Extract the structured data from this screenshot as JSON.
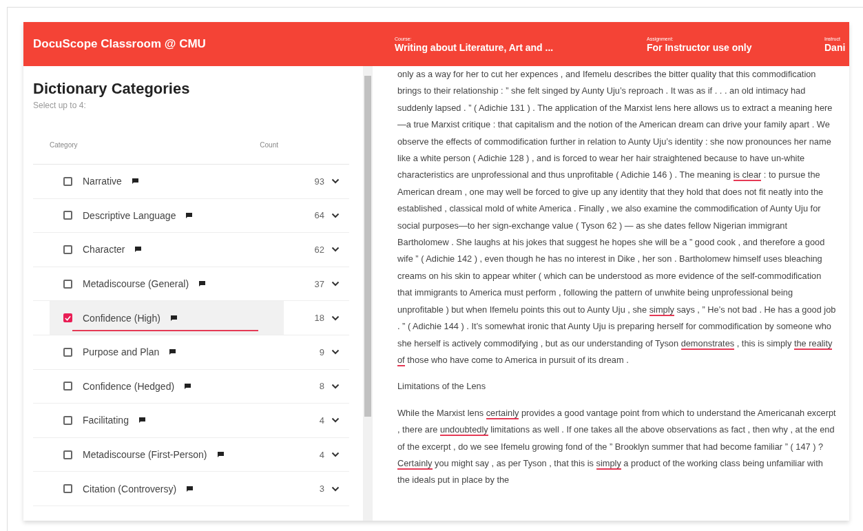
{
  "app_title": "DocuScope Classroom @ CMU",
  "header_fields": [
    {
      "label": "Course:",
      "value": "Writing about Literature, Art and ..."
    },
    {
      "label": "Assignment:",
      "value": "For Instructor use only"
    },
    {
      "label": "Instruct",
      "value": "Dani"
    }
  ],
  "sidebar": {
    "title": "Dictionary Categories",
    "subtitle": "Select up to 4:",
    "columns": [
      "Category",
      "Count"
    ],
    "items": [
      {
        "label": "Narrative",
        "count": "93",
        "checked": false
      },
      {
        "label": "Descriptive Language",
        "count": "64",
        "checked": false
      },
      {
        "label": "Character",
        "count": "62",
        "checked": false
      },
      {
        "label": "Metadiscourse (General)",
        "count": "37",
        "checked": false
      },
      {
        "label": "Confidence (High)",
        "count": "18",
        "checked": true
      },
      {
        "label": "Purpose and Plan",
        "count": "9",
        "checked": false
      },
      {
        "label": "Confidence (Hedged)",
        "count": "8",
        "checked": false
      },
      {
        "label": "Facilitating",
        "count": "4",
        "checked": false
      },
      {
        "label": "Metadiscourse (First-Person)",
        "count": "4",
        "checked": false
      },
      {
        "label": "Citation (Controversy)",
        "count": "3",
        "checked": false
      }
    ]
  },
  "document": {
    "blocks": [
      {
        "kind": "paragraph",
        "segments": [
          {
            "text": "only as a way for her to cut her expences , and Ifemelu describes the bitter quality that this commodification brings to their relationship : ” she felt singed by Aunty Uju’s reproach . It was as if . . . an old intimacy had suddenly lapsed . ” ( Adichie 131 ) . The application of the Marxist lens here allows us to extract a meaning here—a true Marxist critique : that capitalism and the notion of the American dream can drive your family apart . We observe the effects of commodification further in relation to Aunty Uju’s identity : she now pronounces her name like a white person ( Adichie 128 ) , and is forced to wear her hair straightened because to have un-white characteristics are unprofessional and thus unprofitable ( Adichie 146 ) . The meaning ",
            "underlined": false
          },
          {
            "text": "is clear",
            "underlined": true
          },
          {
            "text": " : to pursue the American dream , one may well be forced to give up any identity that they hold that does not fit neatly into the established , classical mold of white America . Finally , we also examine the commodification of Aunty Uju for social purposes—to her sign-exchange value ( Tyson 62 ) — as she dates fellow Nigerian immigrant Bartholomew . She laughs at his jokes that suggest he hopes she will be a ” good cook , and therefore a good wife ” ( Adichie 142 ) , even though he has no interest in Dike , her son . Bartholomew himself uses bleaching creams on his skin to appear whiter ( which can be understood as more evidence of the self-commodification that immigrants to America must perform , following the pattern of unwhite being unprofessional being unprofitable ) but when Ifemelu points this out to Aunty Uju , she ",
            "underlined": false
          },
          {
            "text": "simply",
            "underlined": true
          },
          {
            "text": " says , ” He’s not bad . He has a good job . ” ( Adichie 144 ) . It’s somewhat ironic that Aunty Uju is preparing herself for commodification by someone who she herself is actively commodifying , but as our understanding of Tyson ",
            "underlined": false
          },
          {
            "text": "demonstrates",
            "underlined": true
          },
          {
            "text": " , this is simply ",
            "underlined": false
          },
          {
            "text": "the reality of",
            "underlined": true
          },
          {
            "text": " those who have come to America in pursuit of its dream .",
            "underlined": false
          }
        ]
      },
      {
        "kind": "heading",
        "text": "Limitations of the Lens"
      },
      {
        "kind": "paragraph",
        "segments": [
          {
            "text": "While the Marxist lens ",
            "underlined": false
          },
          {
            "text": "certainly",
            "underlined": true
          },
          {
            "text": " provides a good vantage point from which to understand the Americanah excerpt , there are ",
            "underlined": false
          },
          {
            "text": "undoubtedly",
            "underlined": true
          },
          {
            "text": " limitations as well . If one takes all the above observations as fact , then why , at the end of the excerpt , do we see Ifemelu growing fond of the ” Brooklyn summer that had become familiar ” ( 147 ) ? ",
            "underlined": false
          },
          {
            "text": "Certainly",
            "underlined": true
          },
          {
            "text": " you might say , as per Tyson , that this is ",
            "underlined": false
          },
          {
            "text": "simply",
            "underlined": true
          },
          {
            "text": " a product of the working class being unfamiliar with the ideals put in place by the",
            "underlined": false
          }
        ]
      }
    ]
  }
}
